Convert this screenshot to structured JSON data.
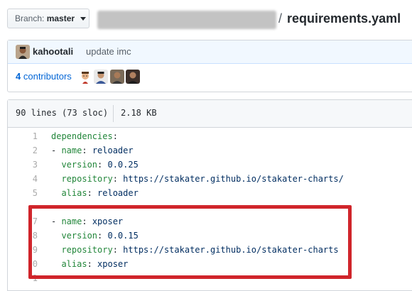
{
  "branch": {
    "label": "Branch:",
    "value": "master"
  },
  "file_path": {
    "separator": "/",
    "filename": "requirements.yaml"
  },
  "commit": {
    "author": "kahootali",
    "message": "update imc"
  },
  "contributors": {
    "count": "4",
    "label": "contributors"
  },
  "file_info": {
    "lines": "90 lines (73 sloc)",
    "size": "2.18 KB"
  },
  "code_lines": [
    {
      "num": "1",
      "key": "dependencies",
      "colon": ":",
      "value": ""
    },
    {
      "num": "2",
      "dash": "- ",
      "key": "name",
      "colon": ": ",
      "value": "reloader"
    },
    {
      "num": "3",
      "indent": "  ",
      "key": "version",
      "colon": ": ",
      "value": "0.0.25"
    },
    {
      "num": "4",
      "indent": "  ",
      "key": "repository",
      "colon": ": ",
      "value": "https://stakater.github.io/stakater-charts/"
    },
    {
      "num": "5",
      "indent": "  ",
      "key": "alias",
      "colon": ": ",
      "value": "reloader"
    },
    {
      "num": "",
      "key": "",
      "colon": "",
      "value": ""
    },
    {
      "num": "7",
      "dash": "- ",
      "key": "name",
      "colon": ": ",
      "value": "xposer"
    },
    {
      "num": "8",
      "indent": "  ",
      "key": "version",
      "colon": ": ",
      "value": "0.0.15"
    },
    {
      "num": "9",
      "indent": "  ",
      "key": "repository",
      "colon": ": ",
      "value": "https://stakater.github.io/stakater-charts"
    },
    {
      "num": "10",
      "indent": "  ",
      "key": "alias",
      "colon": ": ",
      "value": "xposer"
    },
    {
      "num": "1",
      "key": "",
      "colon": "",
      "value": ""
    }
  ],
  "colors": {
    "link": "#0366d6",
    "yaml_key": "#22863a",
    "yaml_value": "#032f62",
    "annotation": "#d0252b"
  }
}
